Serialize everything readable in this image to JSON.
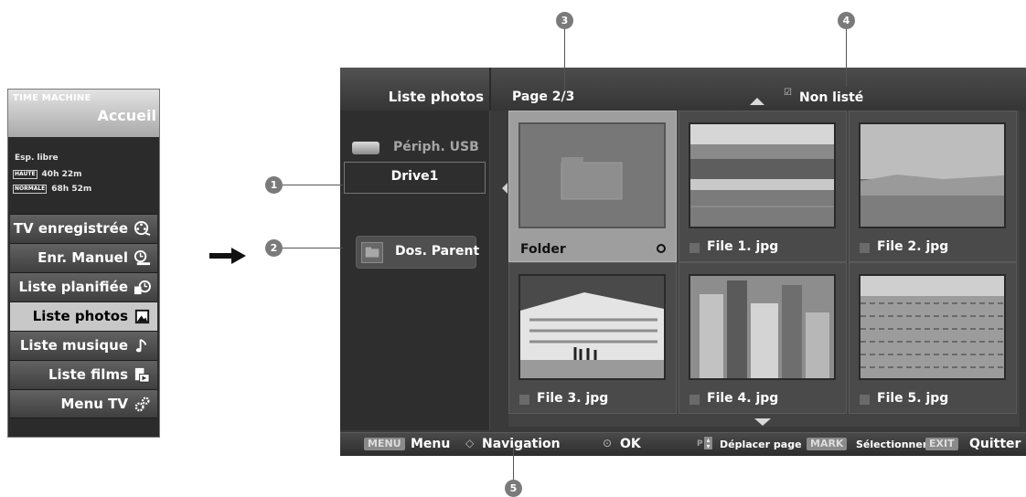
{
  "time_machine": {
    "brand": "TIME MACHINE",
    "home": "Accueil",
    "free_space_label": "Esp. libre",
    "quality_rows": [
      {
        "badge": "HAUTE",
        "time": "40h 22m"
      },
      {
        "badge": "NORMALE",
        "time": "68h 52m"
      }
    ],
    "menu": [
      {
        "label": "TV enregistrée",
        "icon": "recorded-tv-icon"
      },
      {
        "label": "Enr. Manuel",
        "icon": "manual-record-icon"
      },
      {
        "label": "Liste planifiée",
        "icon": "schedule-list-icon"
      },
      {
        "label": "Liste photos",
        "icon": "photo-list-icon",
        "selected": true
      },
      {
        "label": "Liste musique",
        "icon": "music-note-icon"
      },
      {
        "label": "Liste films",
        "icon": "movie-list-icon"
      },
      {
        "label": "Menu TV",
        "icon": "settings-gears-icon"
      }
    ]
  },
  "screen": {
    "title": "Liste photos",
    "device_label": "Périph. USB",
    "drive": "Drive1",
    "parent_button": "Dos. Parent",
    "page": "Page 2/3",
    "unlisted_label": "Non listé",
    "tiles": [
      {
        "name": "Folder",
        "kind": "folder"
      },
      {
        "name": "File 1. jpg",
        "kind": "photo"
      },
      {
        "name": "File 2. jpg",
        "kind": "photo"
      },
      {
        "name": "File 3. jpg",
        "kind": "photo"
      },
      {
        "name": "File 4. jpg",
        "kind": "photo"
      },
      {
        "name": "File 5. jpg",
        "kind": "photo"
      }
    ],
    "bottom_bar": {
      "menu_key": "MENU",
      "menu_label": "Menu",
      "nav_label": "Navigation",
      "ok_label": "OK",
      "page_key": "P",
      "page_label": "Déplacer page",
      "mark_key": "MARK",
      "mark_label": "Sélectionner",
      "exit_key": "EXIT",
      "exit_label": "Quitter"
    }
  },
  "callouts": [
    "1",
    "2",
    "3",
    "4",
    "5"
  ]
}
